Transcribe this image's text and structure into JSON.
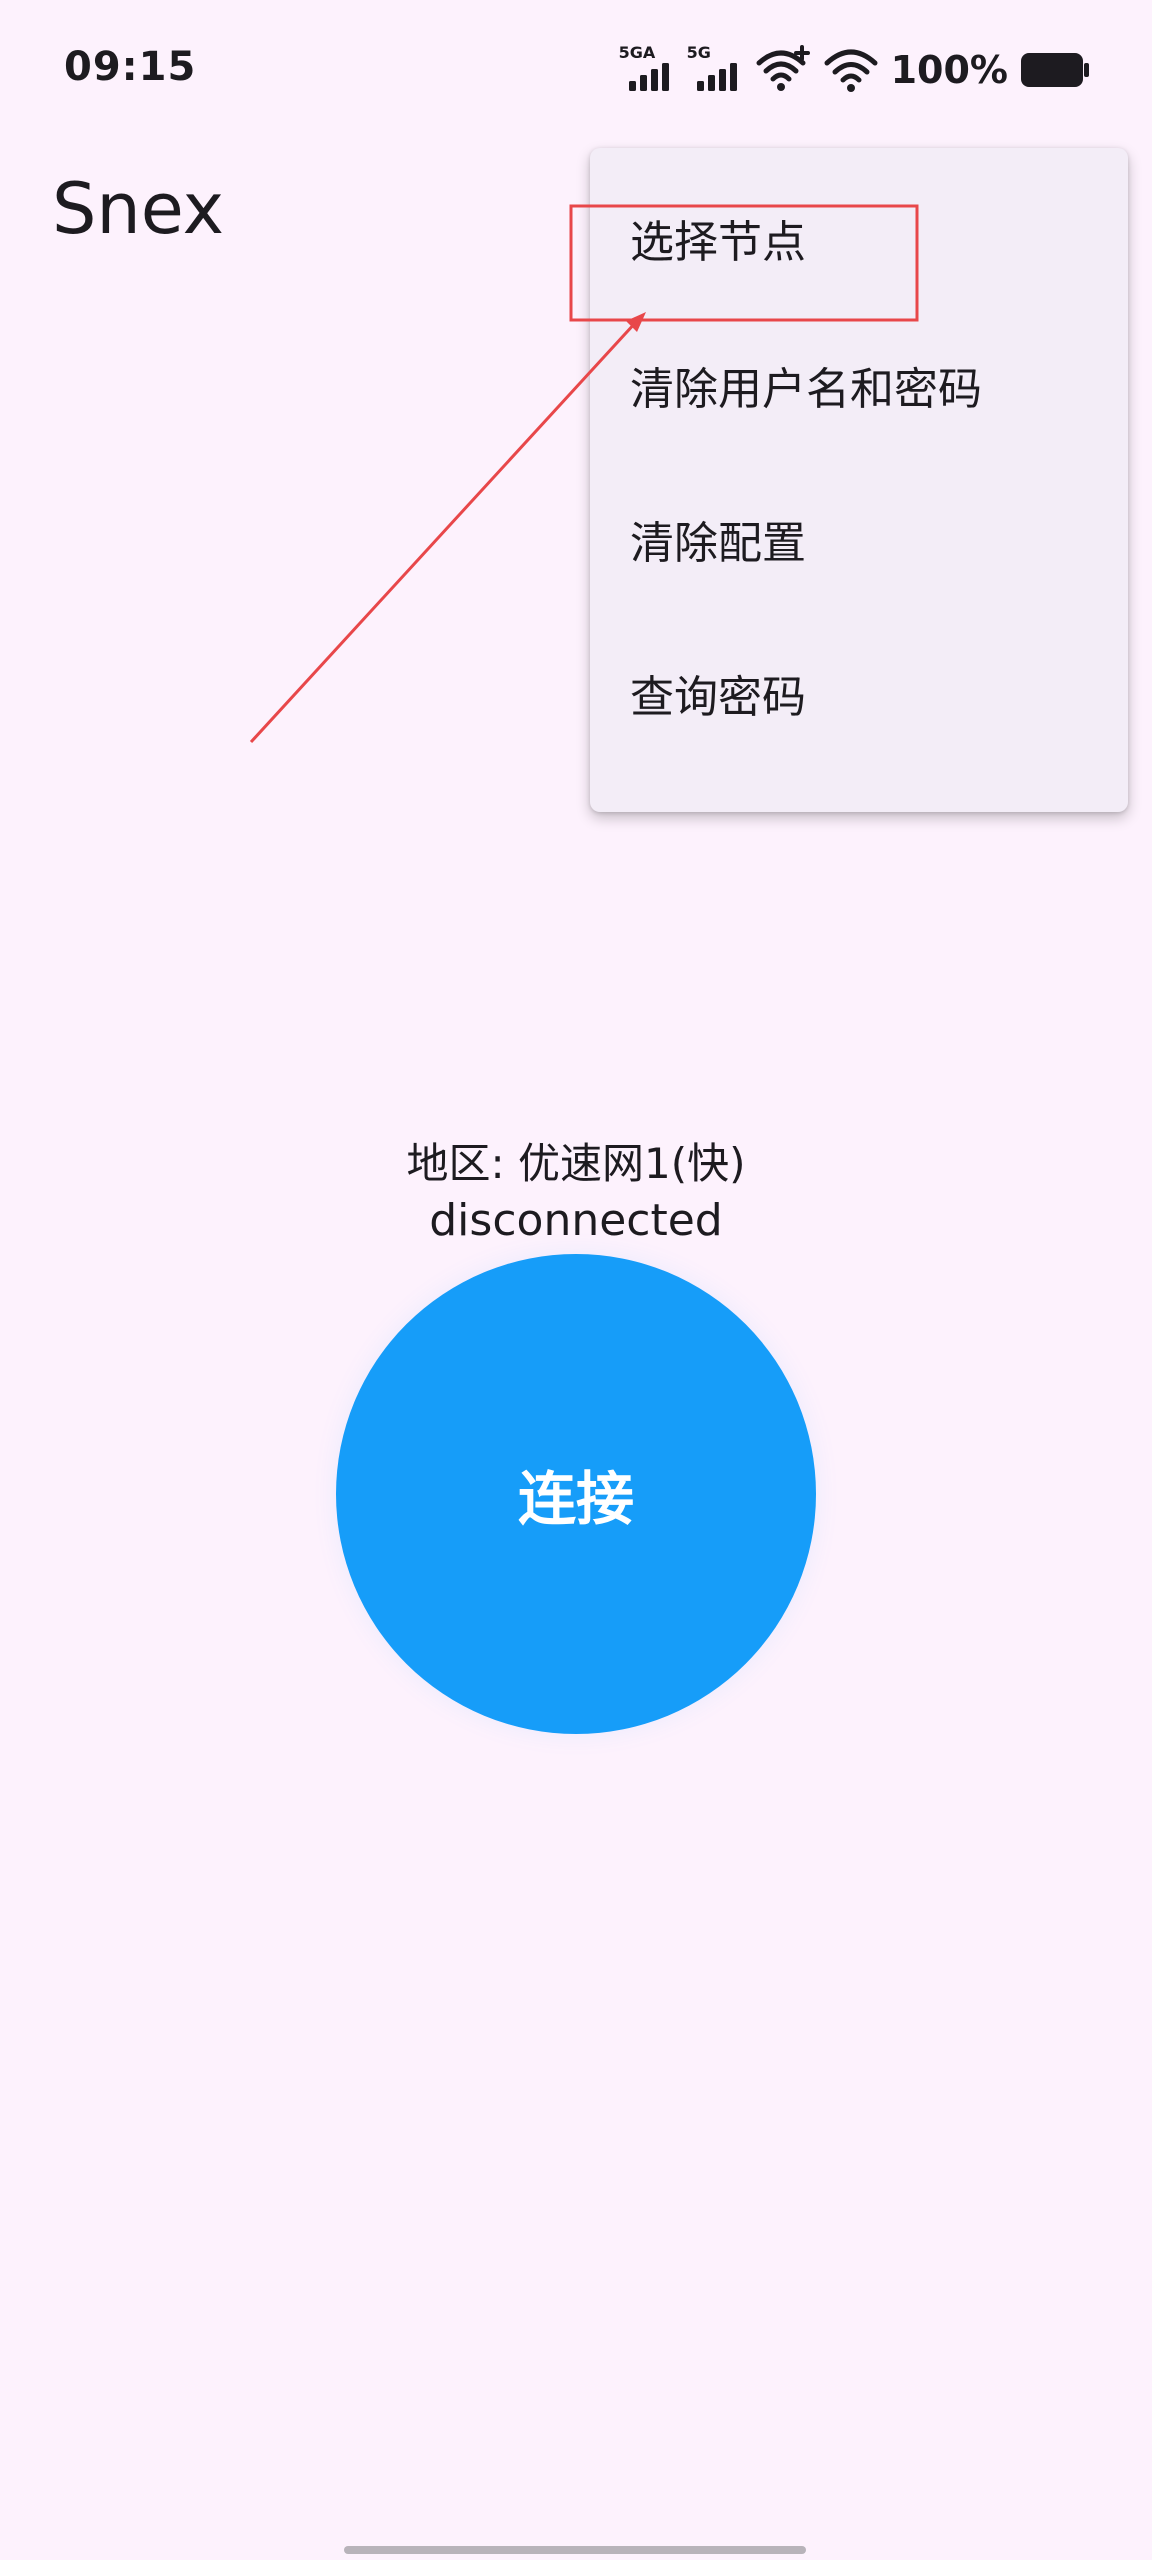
{
  "status_bar": {
    "time": "09:15",
    "network1_label": "5GA",
    "network2_label": "5G",
    "battery_percent": "100%"
  },
  "app": {
    "title": "Snex"
  },
  "menu": {
    "items": [
      {
        "label": "选择节点"
      },
      {
        "label": "清除用户名和密码"
      },
      {
        "label": "清除配置"
      },
      {
        "label": "查询密码"
      }
    ]
  },
  "main": {
    "region_text": "地区: 优速网1(快)",
    "connection_status": "disconnected",
    "connect_label": "连接"
  },
  "colors": {
    "background": "#fdf2fd",
    "menu_background": "#f3edf7",
    "connect_button": "#169df9",
    "annotation": "#e8474a"
  },
  "icons": [
    "signal-5ga-icon",
    "signal-5g-icon",
    "wifi-plus-icon",
    "wifi-icon",
    "battery-icon"
  ]
}
